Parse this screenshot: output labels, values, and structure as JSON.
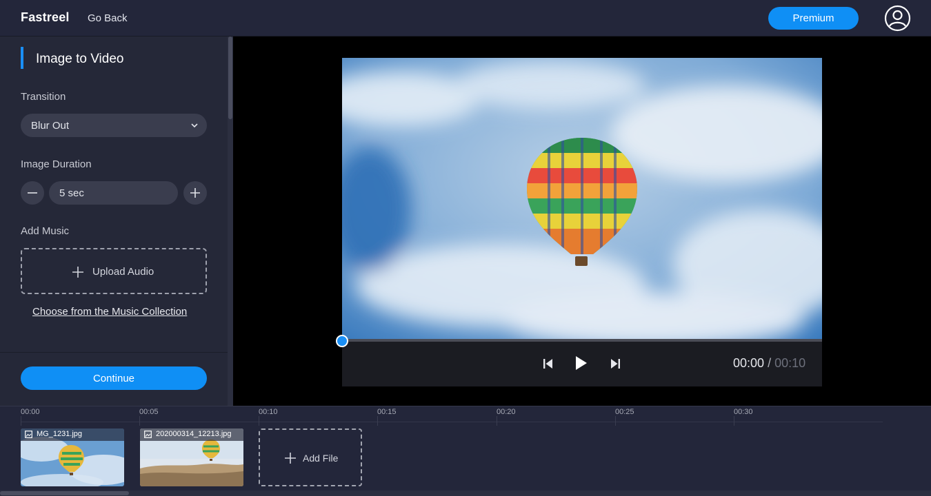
{
  "header": {
    "brand": "Fastreel",
    "go_back": "Go Back",
    "premium": "Premium"
  },
  "sidebar": {
    "section_title": "Image to Video",
    "transition_label": "Transition",
    "transition_value": "Blur Out",
    "duration_label": "Image Duration",
    "duration_value": "5 sec",
    "music_label": "Add Music",
    "upload_audio": "Upload Audio",
    "music_collection": "Choose from the Music Collection",
    "continue": "Continue"
  },
  "player": {
    "current_time": "00:00",
    "separator": "/",
    "total_time": "00:10",
    "progress": 0
  },
  "timeline": {
    "ticks": [
      "00:00",
      "00:05",
      "00:10",
      "00:15",
      "00:20",
      "00:25",
      "00:30"
    ],
    "clips": [
      {
        "name": "MG_1231.jpg"
      },
      {
        "name": "202000314_12213.jpg"
      }
    ],
    "add_file": "Add File"
  },
  "icons": [
    "user-account-icon",
    "chevron-down-icon",
    "minus-icon",
    "plus-icon",
    "skip-back-icon",
    "play-icon",
    "skip-forward-icon",
    "image-file-icon"
  ],
  "colors": {
    "accent": "#0f8ff5",
    "background": "#1e2130",
    "panel": "#252838"
  }
}
